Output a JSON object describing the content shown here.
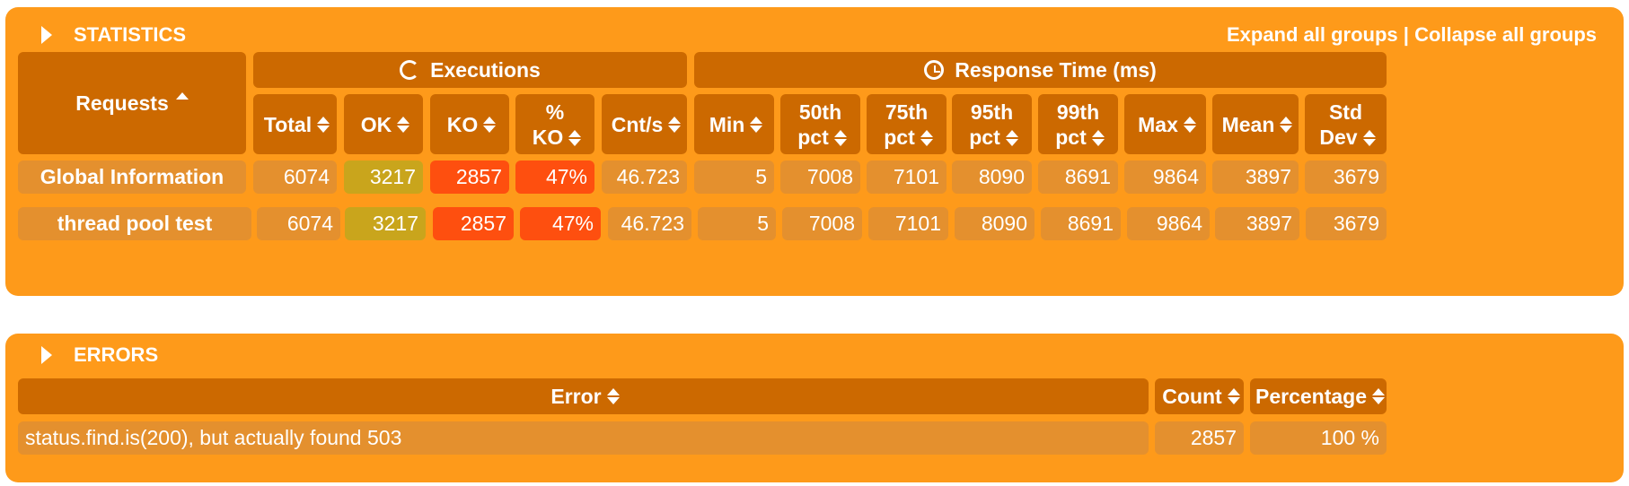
{
  "statistics": {
    "title": "STATISTICS",
    "expand_all": "Expand all groups",
    "separator": " | ",
    "collapse_all": "Collapse all groups",
    "requests_header": "Requests",
    "executions_header": "Executions",
    "response_time_header": "Response Time (ms)",
    "columns": {
      "total": "Total",
      "ok": "OK",
      "ko": "KO",
      "pct_ko_1": "%",
      "pct_ko_2": "KO",
      "cnt_s": "Cnt/s",
      "min": "Min",
      "p50_1": "50th",
      "p50_2": "pct",
      "p75_1": "75th",
      "p75_2": "pct",
      "p95_1": "95th",
      "p95_2": "pct",
      "p99_1": "99th",
      "p99_2": "pct",
      "max": "Max",
      "mean": "Mean",
      "std_1": "Std",
      "std_2": "Dev"
    },
    "rows": [
      {
        "name": "Global Information",
        "total": "6074",
        "ok": "3217",
        "ko": "2857",
        "pct_ko": "47%",
        "cnt_s": "46.723",
        "min": "5",
        "p50": "7008",
        "p75": "7101",
        "p95": "8090",
        "p99": "8691",
        "max": "9864",
        "mean": "3897",
        "std": "3679"
      },
      {
        "name": "thread pool test",
        "total": "6074",
        "ok": "3217",
        "ko": "2857",
        "pct_ko": "47%",
        "cnt_s": "46.723",
        "min": "5",
        "p50": "7008",
        "p75": "7101",
        "p95": "8090",
        "p99": "8691",
        "max": "9864",
        "mean": "3897",
        "std": "3679"
      }
    ]
  },
  "errors": {
    "title": "ERRORS",
    "headers": {
      "error": "Error",
      "count": "Count",
      "percentage": "Percentage"
    },
    "rows": [
      {
        "error": "status.find.is(200), but actually found 503",
        "count": "2857",
        "percentage": "100 %"
      }
    ]
  }
}
